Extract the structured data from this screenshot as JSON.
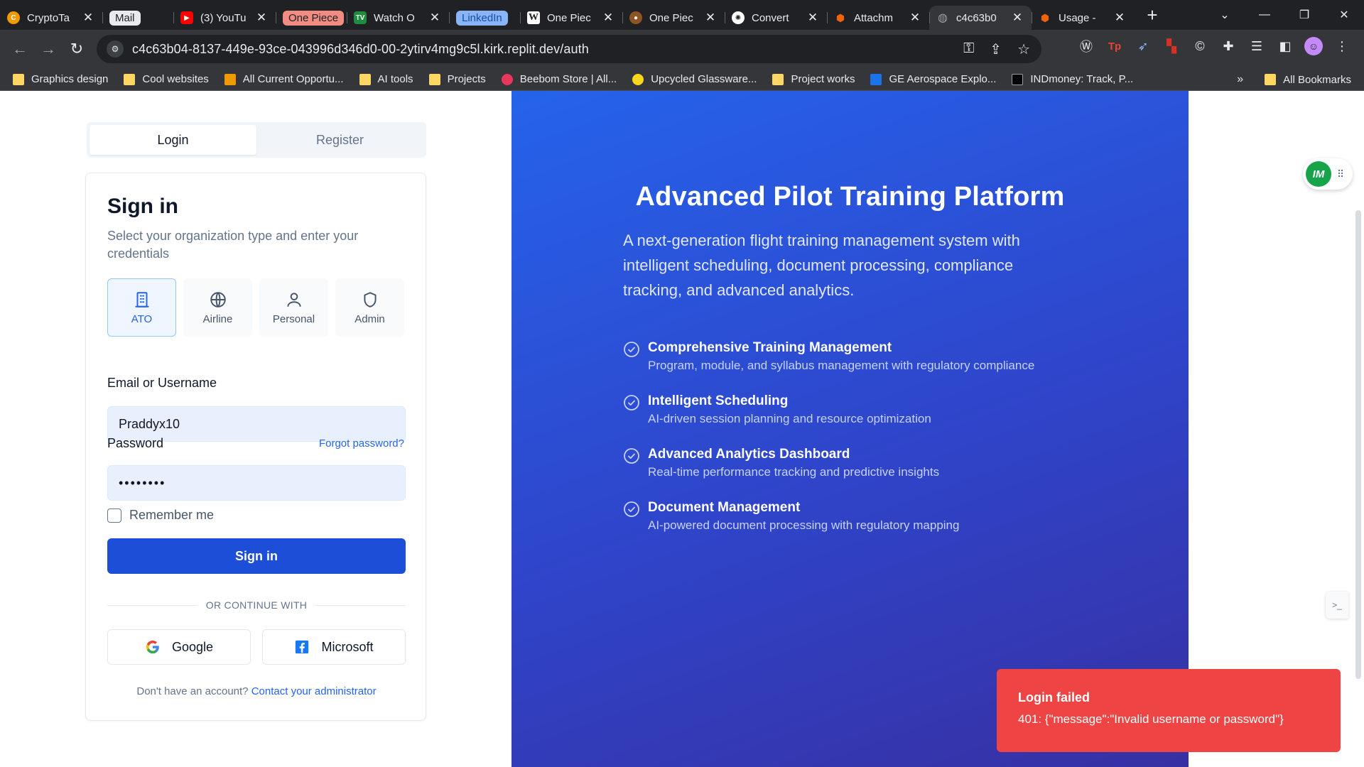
{
  "browser": {
    "tabs": [
      {
        "label": "CryptoTa",
        "favicon": "c-orange",
        "color": "#f29900"
      },
      {
        "label": "Mail",
        "pill_bg": "#e8eaed",
        "pill_fg": "#202124"
      },
      {
        "label": "(3) YouTu",
        "favicon": "youtube-icon",
        "color": "#ff0000"
      },
      {
        "label": "One Piece",
        "pill_bg": "#f28b82",
        "pill_fg": "#202124"
      },
      {
        "label": "Watch O",
        "favicon": "tv-icon",
        "color": "#1e8e3e"
      },
      {
        "label": "LinkedIn",
        "pill_bg": "#8ab4f8",
        "pill_fg": "#174ea6"
      },
      {
        "label": "One Piec",
        "favicon": "wikipedia-icon",
        "color": "#ffffff"
      },
      {
        "label": "One Piec",
        "favicon": "monkey-icon",
        "color": "#8d5524"
      },
      {
        "label": "Convert",
        "favicon": "openai-icon",
        "color": "#ffffff"
      },
      {
        "label": "Attachm",
        "favicon": "replit-icon",
        "color": "#f26207"
      },
      {
        "label": "c4c63b0",
        "favicon": "globe-icon",
        "color": "#9aa0a6",
        "active": true
      },
      {
        "label": "Usage -",
        "favicon": "replit-icon",
        "color": "#f26207"
      }
    ],
    "new_tab": "+",
    "url": "c4c63b04-8137-449e-93ce-043996d346d0-00-2ytirv4mg9c5l.kirk.replit.dev/auth",
    "bookmarks": [
      {
        "label": "Graphics design",
        "icon": "folder-icon",
        "color": "#fdd663"
      },
      {
        "label": "Cool websites",
        "icon": "folder-icon",
        "color": "#fdd663"
      },
      {
        "label": "All Current Opportu...",
        "icon": "site-icon",
        "color": "#f29900"
      },
      {
        "label": "AI tools",
        "icon": "folder-icon",
        "color": "#fdd663"
      },
      {
        "label": "Projects",
        "icon": "folder-icon",
        "color": "#fdd663"
      },
      {
        "label": "Beebom Store | All...",
        "icon": "site-icon",
        "color": "#e8375a"
      },
      {
        "label": "Upcycled Glassware...",
        "icon": "site-icon",
        "color": "#f9d71c"
      },
      {
        "label": "Project works",
        "icon": "folder-icon",
        "color": "#fdd663"
      },
      {
        "label": "GE Aerospace Explo...",
        "icon": "site-icon",
        "color": "#1a73e8"
      },
      {
        "label": "INDmoney: Track, P...",
        "icon": "site-icon",
        "color": "#000000"
      }
    ],
    "bookmarks_overflow": "»",
    "all_bookmarks": "All Bookmarks"
  },
  "auth": {
    "tabs": {
      "login": "Login",
      "register": "Register"
    },
    "title": "Sign in",
    "subtitle": "Select your organization type and enter your credentials",
    "org_types": [
      {
        "label": "ATO",
        "icon": "building-icon",
        "selected": true
      },
      {
        "label": "Airline",
        "icon": "globe-icon",
        "selected": false
      },
      {
        "label": "Personal",
        "icon": "user-icon",
        "selected": false
      },
      {
        "label": "Admin",
        "icon": "shield-icon",
        "selected": false
      }
    ],
    "email_label": "Email or Username",
    "email_value": "Praddyx10",
    "password_label": "Password",
    "password_value": "••••••••",
    "forgot_password": "Forgot password?",
    "remember_me": "Remember me",
    "submit": "Sign in",
    "divider": "OR CONTINUE WITH",
    "google": "Google",
    "microsoft": "Microsoft",
    "no_account": "Don't have an account?",
    "contact_admin": "Contact your administrator"
  },
  "hero": {
    "title": "Advanced Pilot Training Platform",
    "lead": "A next-generation flight training management system with intelligent scheduling, document processing, compliance tracking, and advanced analytics.",
    "features": [
      {
        "title": "Comprehensive Training Management",
        "desc": "Program, module, and syllabus management with regulatory compliance"
      },
      {
        "title": "Intelligent Scheduling",
        "desc": "AI-driven session planning and resource optimization"
      },
      {
        "title": "Advanced Analytics Dashboard",
        "desc": "Real-time performance tracking and predictive insights"
      },
      {
        "title": "Document Management",
        "desc": "AI-powered document processing with regulatory mapping"
      }
    ]
  },
  "toast": {
    "title": "Login failed",
    "message": "401: {\"message\":\"Invalid username or password\"}"
  },
  "widgets": {
    "im_logo": "IM"
  },
  "colors": {
    "primary": "#1d4ed8",
    "hero_start": "#2563eb",
    "hero_end": "#3730a3",
    "error": "#ef4444"
  }
}
